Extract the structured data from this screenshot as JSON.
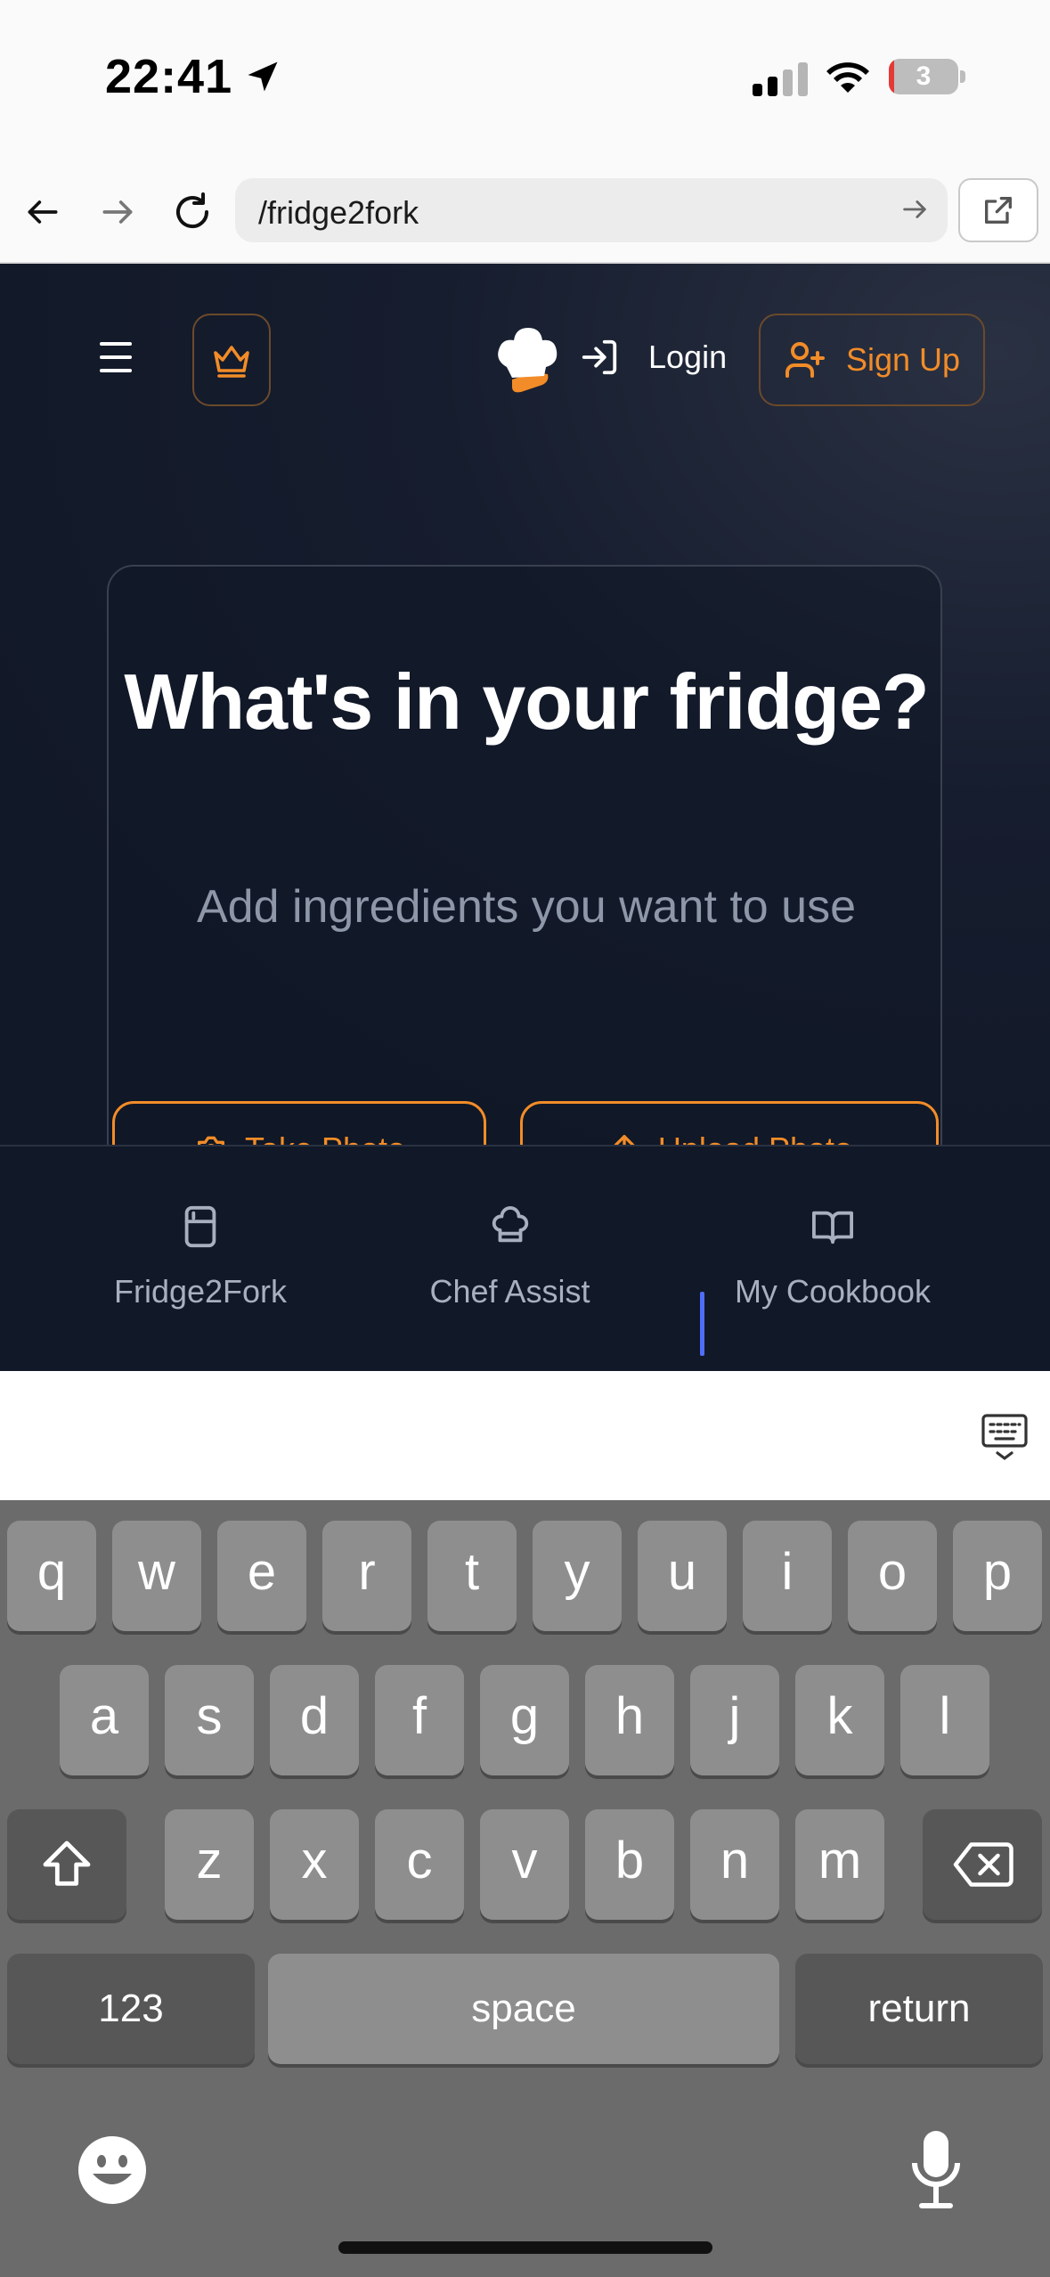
{
  "status": {
    "time": "22:41",
    "battery": "3",
    "icons": [
      "location-arrow-icon",
      "signal-icon",
      "wifi-icon",
      "battery-icon"
    ]
  },
  "browser": {
    "url": "/fridge2fork"
  },
  "app": {
    "login_label": "Login",
    "signup_label": "Sign Up",
    "hero_title": "What's in your fridge?",
    "hero_subtitle": "Add ingredients you want to use",
    "take_photo_label": "Take Photo",
    "upload_photo_label": "Upload Photo",
    "accent_color": "#f28c28"
  },
  "bottom_nav": [
    {
      "label": "Fridge2Fork",
      "icon": "fridge-icon"
    },
    {
      "label": "Chef Assist",
      "icon": "chef-hat-icon"
    },
    {
      "label": "My Cookbook",
      "icon": "book-open-icon"
    }
  ],
  "keyboard": {
    "row1": [
      "q",
      "w",
      "e",
      "r",
      "t",
      "y",
      "u",
      "i",
      "o",
      "p"
    ],
    "row2": [
      "a",
      "s",
      "d",
      "f",
      "g",
      "h",
      "j",
      "k",
      "l"
    ],
    "row3": [
      "z",
      "x",
      "c",
      "v",
      "b",
      "n",
      "m"
    ],
    "numbers_label": "123",
    "space_label": "space",
    "return_label": "return"
  }
}
